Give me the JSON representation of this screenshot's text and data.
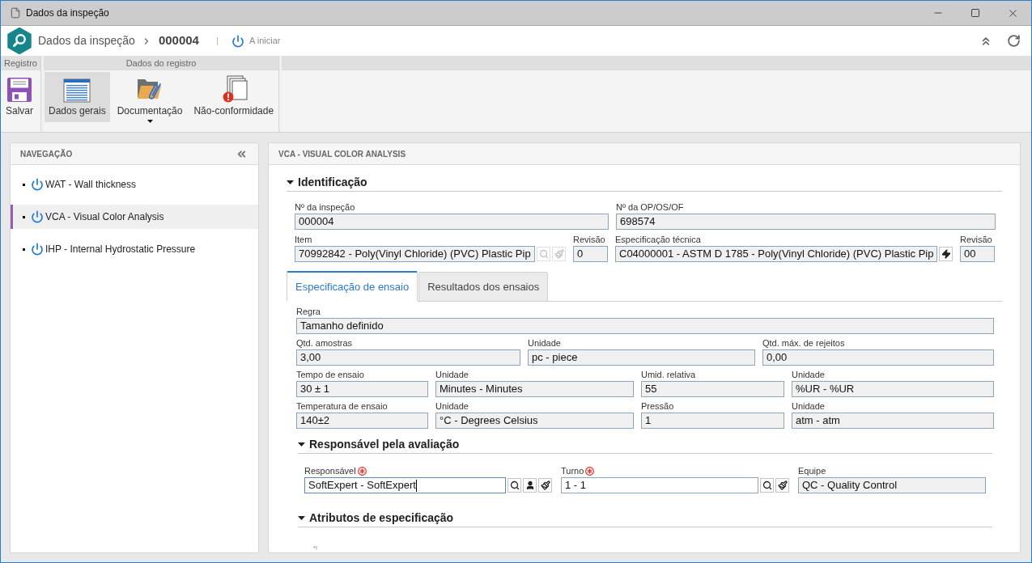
{
  "window": {
    "title": "Dados da inspeção"
  },
  "header": {
    "module": "Dados da inspeção",
    "record": "000004",
    "status": "A iniciar"
  },
  "ribbon": {
    "groups": [
      {
        "title": "Registro",
        "buttons": [
          {
            "kind": "save",
            "label": "Salvar",
            "selected": false
          }
        ]
      },
      {
        "title": "Dados do registro",
        "buttons": [
          {
            "kind": "general",
            "label": "Dados gerais",
            "selected": true
          },
          {
            "kind": "documents",
            "label": "Documentação",
            "selected": false,
            "menu": true
          },
          {
            "kind": "nonconformity",
            "label": "Não-conformidade",
            "selected": false
          }
        ]
      }
    ]
  },
  "navigation": {
    "title": "NAVEGAÇÃO",
    "items": [
      {
        "label": "WAT - Wall thickness",
        "selected": false
      },
      {
        "label": "VCA - Visual Color Analysis",
        "selected": true
      },
      {
        "label": "IHP - Internal Hydrostatic Pressure",
        "selected": false
      }
    ]
  },
  "panel": {
    "title": "VCA - VISUAL COLOR ANALYSIS",
    "identification": {
      "title": "Identificação",
      "expanded": true,
      "fields": [
        {
          "label": "Nº da inspeção",
          "value": "000004",
          "editable": false
        },
        {
          "label": "Nº da OP/OS/OF",
          "value": "698574",
          "editable": false
        },
        {
          "label": "Item",
          "value": "70992842 - Poly(Vinyl Chloride) (PVC) Plastic Pip",
          "editable": false,
          "buttons": [
            {
              "kind": "search",
              "disabled": true
            },
            {
              "kind": "clear",
              "disabled": true
            }
          ]
        },
        {
          "label": "Revisão",
          "value": "0",
          "editable": false
        },
        {
          "label": "Especificação técnica",
          "value": "C04000001 - ASTM D 1785 - Poly(Vinyl Chloride) (PVC) Plastic Pip",
          "editable": false,
          "buttons": [
            {
              "kind": "action",
              "disabled": false
            }
          ]
        },
        {
          "label": "Revisão",
          "value": "00",
          "editable": false
        }
      ]
    },
    "tabs": [
      {
        "label": "Especificação de ensaio",
        "selected": true
      },
      {
        "label": "Resultados dos ensaios",
        "selected": false
      }
    ],
    "test_spec": {
      "fields": [
        {
          "label": "Regra",
          "value": "Tamanho definido",
          "editable": false
        },
        {
          "label": "Qtd. amostras",
          "value": "3,00",
          "editable": false
        },
        {
          "label": "Unidade",
          "value": "pc - piece",
          "editable": false
        },
        {
          "label": "Qtd. máx. de rejeitos",
          "value": "0,00",
          "editable": false
        },
        {
          "label": "Tempo de ensaio",
          "value": "30 ± 1",
          "editable": false
        },
        {
          "label": "Unidade",
          "value": "Minutes - Minutes",
          "editable": false
        },
        {
          "label": "Umid. relativa",
          "value": "55",
          "editable": false
        },
        {
          "label": "Unidade",
          "value": "%UR - %UR",
          "editable": false
        },
        {
          "label": "Temperatura de ensaio",
          "value": "140±2",
          "editable": false
        },
        {
          "label": "Unidade",
          "value": "°C - Degrees Celsius",
          "editable": false
        },
        {
          "label": "Pressão",
          "value": "1",
          "editable": false
        },
        {
          "label": "Unidade",
          "value": "atm - atm",
          "editable": false
        }
      ]
    },
    "evaluation": {
      "title": "Responsável pela avaliação",
      "expanded": true,
      "fields": [
        {
          "label": "Responsável",
          "value": "SoftExpert - SoftExpert",
          "required": true,
          "editable": true,
          "focused": true,
          "buttons": [
            {
              "kind": "search",
              "disabled": false
            },
            {
              "kind": "user",
              "disabled": false
            },
            {
              "kind": "clear",
              "disabled": false
            }
          ]
        },
        {
          "label": "Turno",
          "value": "1 - 1",
          "required": true,
          "editable": true,
          "focused": false,
          "buttons": [
            {
              "kind": "search",
              "disabled": false
            },
            {
              "kind": "clear",
              "disabled": false
            }
          ]
        },
        {
          "label": "Equipe",
          "value": "QC - Quality Control",
          "required": false,
          "editable": false,
          "focused": false
        }
      ]
    },
    "attributes": {
      "title": "Atributos de especificação",
      "expanded": true,
      "note": "*!"
    }
  }
}
